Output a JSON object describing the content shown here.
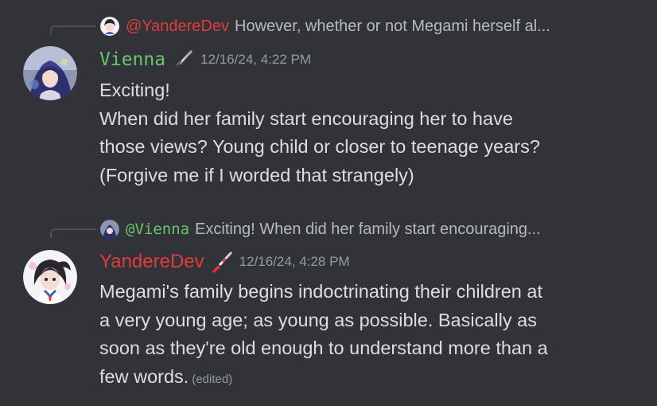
{
  "colors": {
    "background": "#323339",
    "text": "#dbdee1",
    "muted": "#949ba4",
    "vienna": "#67c56b",
    "yandere": "#e23b3b"
  },
  "messages": [
    {
      "reply": {
        "mention": "@YandereDev",
        "text": "However, whether or not Megami herself al..."
      },
      "author": "Vienna",
      "author_role_icon": "dagger-icon",
      "timestamp": "12/16/24, 4:22 PM",
      "lines": [
        "Exciting!",
        "When did her family start encouraging her to have",
        "those views? Young child or closer to teenage years?",
        "(Forgive me if I worded that strangely)"
      ]
    },
    {
      "reply": {
        "mention": "@Vienna",
        "text": "Exciting!  When did her family start encouraging..."
      },
      "author": "YandereDev",
      "author_role_icon": "knife-icon",
      "timestamp": "12/16/24, 4:28 PM",
      "lines": [
        "Megami's family begins indoctrinating their children at",
        "a very young age; as young as possible. Basically as",
        "soon as they're old enough to understand more than a",
        "few words."
      ],
      "edited_label": "(edited)"
    }
  ]
}
